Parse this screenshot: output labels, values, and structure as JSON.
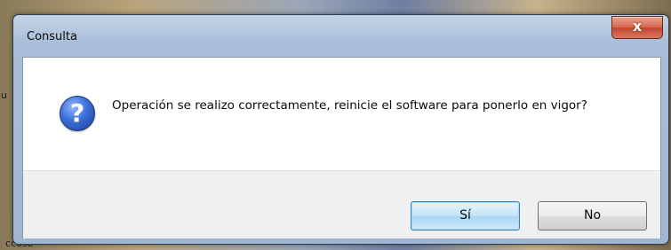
{
  "background": {
    "left_char": "u",
    "bottom_text": "ccoso"
  },
  "dialog": {
    "title": "Consulta",
    "close_label": "x",
    "icon": "question-icon",
    "message": "Operación se realizo correctamente, reinicie el software para ponerlo en vigor?",
    "buttons": {
      "yes_label": "Sí",
      "no_label": "No"
    }
  },
  "colors": {
    "accent_button_border": "#3c7fb1",
    "close_button": "#c2452d",
    "icon_blue": "#3a6fd8"
  }
}
